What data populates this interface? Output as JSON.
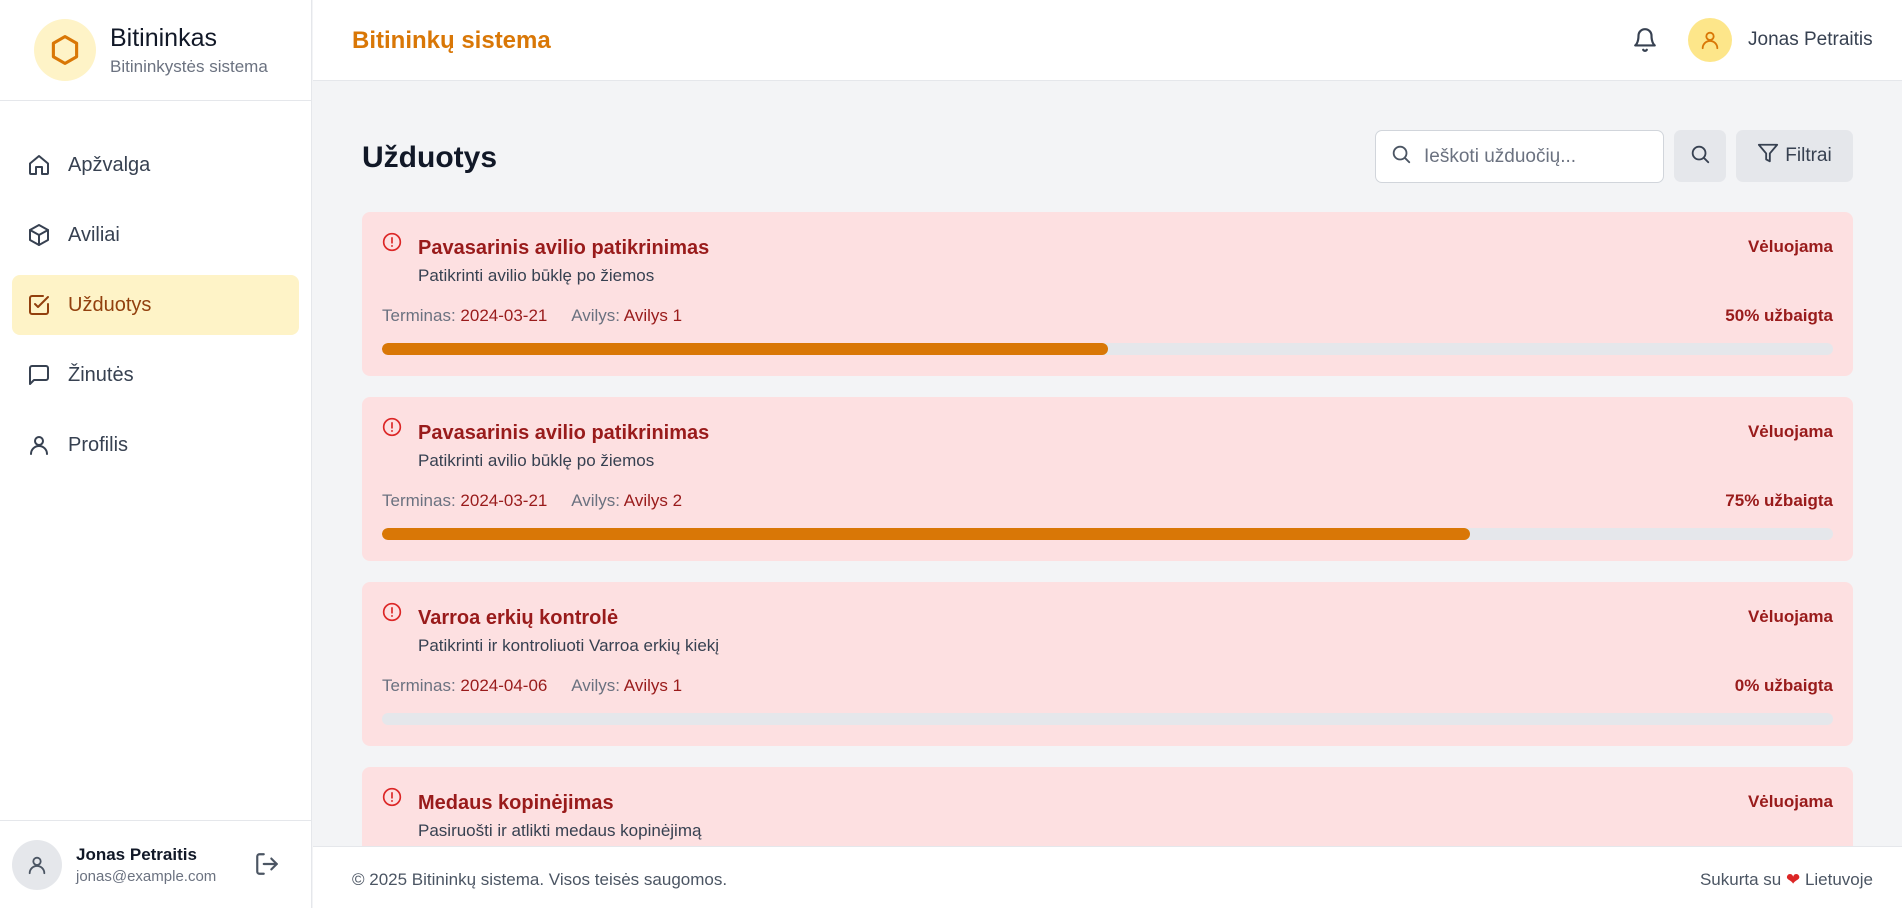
{
  "brand": {
    "name": "Bitininkas",
    "subtitle": "Bitininkystės sistema",
    "logo_icon": "hexagon-icon",
    "accent_color": "#d97706"
  },
  "sidebar": {
    "items": [
      {
        "label": "Apžvalga",
        "icon": "home-icon",
        "active": false
      },
      {
        "label": "Aviliai",
        "icon": "box-icon",
        "active": false
      },
      {
        "label": "Užduotys",
        "icon": "check-square-icon",
        "active": true
      },
      {
        "label": "Žinutės",
        "icon": "message-icon",
        "active": false
      },
      {
        "label": "Profilis",
        "icon": "user-icon",
        "active": false
      }
    ],
    "user": {
      "name": "Jonas Petraitis",
      "email": "jonas@example.com"
    }
  },
  "header": {
    "title": "Bitininkų sistema",
    "user_name": "Jonas Petraitis"
  },
  "main": {
    "page_title": "Užduotys",
    "search_placeholder": "Ieškoti užduočių...",
    "filter_label": "Filtrai",
    "tasks": [
      {
        "title": "Pavasarinis avilio patikrinimas",
        "description": "Patikrinti avilio būklę po žiemos",
        "status": "Vėluojama",
        "deadline_label": "Terminas:",
        "deadline": "2024-03-21",
        "hive_label": "Avilys:",
        "hive": "Avilys 1",
        "progress_text": "50% užbaigta",
        "progress": 0.5
      },
      {
        "title": "Pavasarinis avilio patikrinimas",
        "description": "Patikrinti avilio būklę po žiemos",
        "status": "Vėluojama",
        "deadline_label": "Terminas:",
        "deadline": "2024-03-21",
        "hive_label": "Avilys:",
        "hive": "Avilys 2",
        "progress_text": "75% užbaigta",
        "progress": 0.75
      },
      {
        "title": "Varroa erkių kontrolė",
        "description": "Patikrinti ir kontroliuoti Varroa erkių kiekį",
        "status": "Vėluojama",
        "deadline_label": "Terminas:",
        "deadline": "2024-04-06",
        "hive_label": "Avilys:",
        "hive": "Avilys 1",
        "progress_text": "0% užbaigta",
        "progress": 0
      },
      {
        "title": "Medaus kopinėjimas",
        "description": "Pasiruošti ir atlikti medaus kopinėjimą",
        "status": "Vėluojama"
      }
    ]
  },
  "footer": {
    "copyright": "© 2025 Bitininkų sistema. Visos teisės saugomos.",
    "made_prefix": "Sukurta su",
    "heart": "❤",
    "made_suffix": "Lietuvoje"
  }
}
